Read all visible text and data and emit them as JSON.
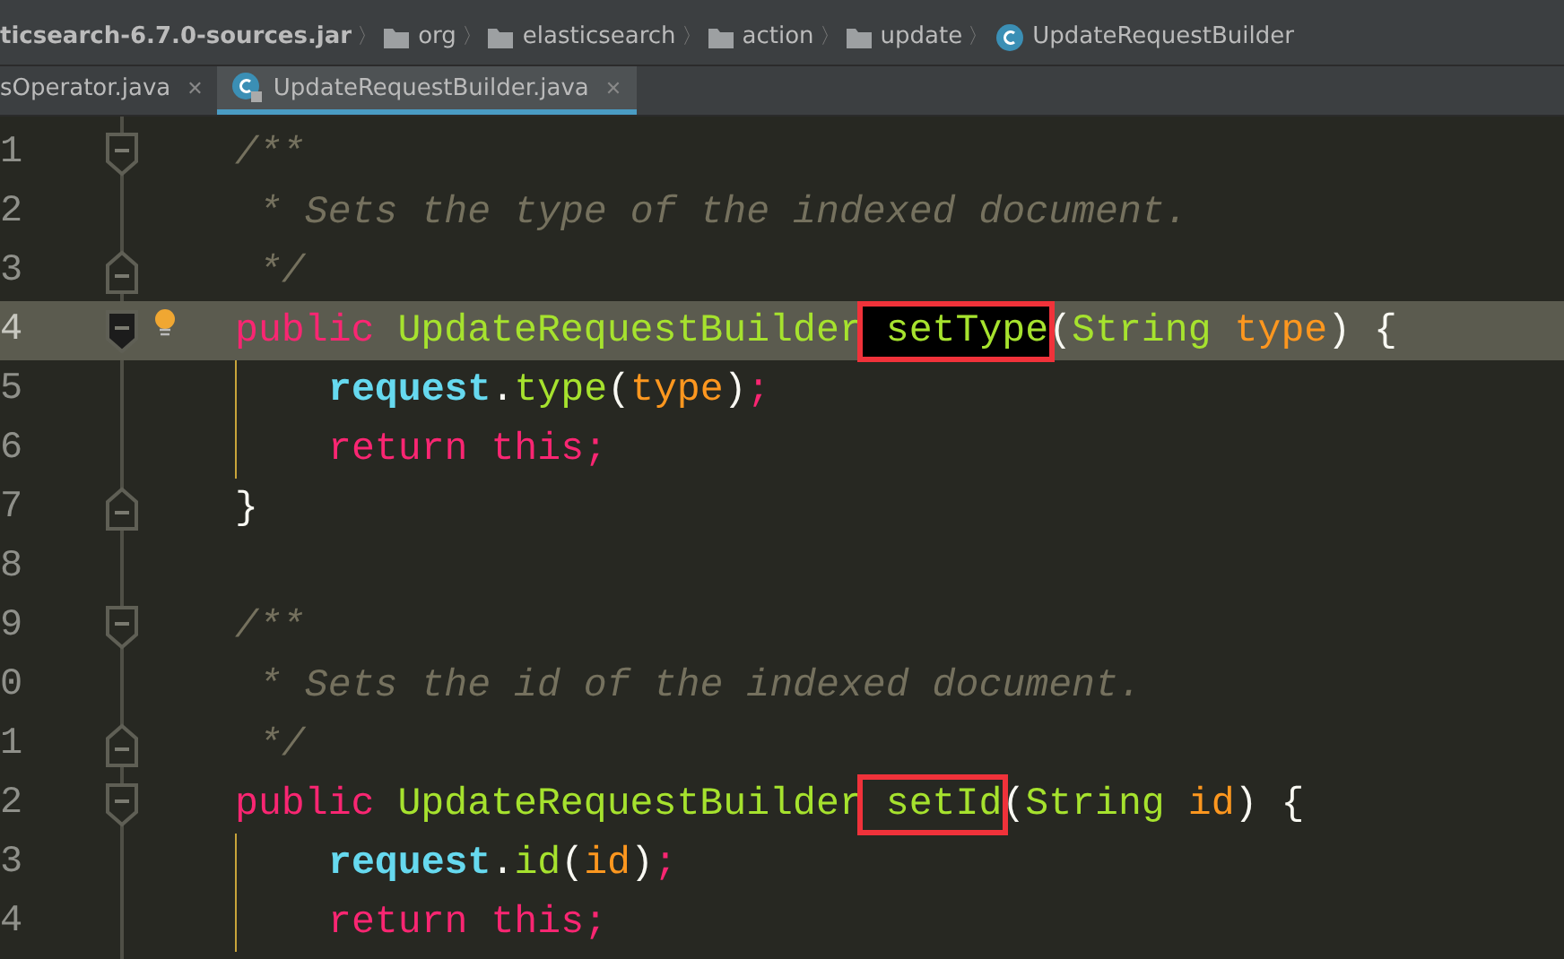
{
  "breadcrumbs": [
    {
      "label": "ticsearch-6.7.0-sources.jar",
      "kind": "jar"
    },
    {
      "separator": "〉",
      "label": "org",
      "kind": "folder"
    },
    {
      "separator": "〉",
      "label": "elasticsearch",
      "kind": "folder"
    },
    {
      "separator": "〉",
      "label": "action",
      "kind": "folder"
    },
    {
      "separator": "〉",
      "label": "update",
      "kind": "folder"
    },
    {
      "separator": "〉",
      "label": "UpdateRequestBuilder",
      "kind": "class"
    }
  ],
  "tabs": [
    {
      "label": "sOperator.java",
      "close": "✕",
      "selected": false,
      "icon": false
    },
    {
      "label": "UpdateRequestBuilder.java",
      "close": "✕",
      "selected": true,
      "icon": true
    }
  ],
  "editor": {
    "lines": [
      {
        "number": "1",
        "kind": "doc",
        "fold_start": true,
        "fold_end": false,
        "current": false,
        "bulb": false,
        "guide": false,
        "tokens": [
          {
            "text": "/**",
            "kind": "comment",
            "boxed": false
          }
        ]
      },
      {
        "number": "2",
        "kind": "doc-inner",
        "fold_start": false,
        "fold_end": false,
        "current": false,
        "bulb": false,
        "guide": false,
        "tokens": [
          {
            "text": "* Sets the type of the indexed document.",
            "kind": "comment",
            "boxed": false
          }
        ]
      },
      {
        "number": "3",
        "kind": "doc-inner",
        "fold_start": false,
        "fold_end": true,
        "current": false,
        "bulb": false,
        "guide": false,
        "tokens": [
          {
            "text": "*/",
            "kind": "comment",
            "boxed": false
          }
        ]
      },
      {
        "number": "4",
        "kind": "code",
        "fold_start": true,
        "fold_end": false,
        "current": true,
        "bulb": true,
        "guide": false,
        "tokens": [
          {
            "text": "public",
            "kind": "keyword",
            "boxed": false
          },
          {
            "text": " UpdateRequestBuilder",
            "kind": "type",
            "boxed": false
          },
          {
            "text": " setType",
            "kind": "selected-method",
            "boxed": true
          },
          {
            "text": "(",
            "kind": "plain",
            "boxed": false
          },
          {
            "text": "String",
            "kind": "type",
            "boxed": false
          },
          {
            "text": " type",
            "kind": "param",
            "boxed": false
          },
          {
            "text": ") {",
            "kind": "plain",
            "boxed": false
          }
        ]
      },
      {
        "number": "5",
        "kind": "body",
        "fold_start": false,
        "fold_end": false,
        "current": false,
        "bulb": false,
        "guide": true,
        "tokens": [
          {
            "text": "request",
            "kind": "field",
            "boxed": false
          },
          {
            "text": ".",
            "kind": "plain",
            "boxed": false
          },
          {
            "text": "type",
            "kind": "type",
            "boxed": false
          },
          {
            "text": "(",
            "kind": "plain",
            "boxed": false
          },
          {
            "text": "type",
            "kind": "param",
            "boxed": false
          },
          {
            "text": ")",
            "kind": "plain",
            "boxed": false
          },
          {
            "text": ";",
            "kind": "keyword",
            "boxed": false
          }
        ]
      },
      {
        "number": "6",
        "kind": "body",
        "fold_start": false,
        "fold_end": false,
        "current": false,
        "bulb": false,
        "guide": true,
        "tokens": [
          {
            "text": "return this;",
            "kind": "keyword",
            "boxed": false
          }
        ]
      },
      {
        "number": "7",
        "kind": "code",
        "fold_start": false,
        "fold_end": true,
        "current": false,
        "bulb": false,
        "guide": false,
        "tokens": [
          {
            "text": "}",
            "kind": "plain",
            "boxed": false
          }
        ]
      },
      {
        "number": "8",
        "kind": "code",
        "fold_start": false,
        "fold_end": false,
        "current": false,
        "bulb": false,
        "guide": false
      },
      {
        "number": "9",
        "kind": "doc",
        "fold_start": true,
        "fold_end": false,
        "current": false,
        "bulb": false,
        "guide": false,
        "tokens": [
          {
            "text": "/**",
            "kind": "comment",
            "boxed": false
          }
        ]
      },
      {
        "number": "0",
        "kind": "doc-inner",
        "fold_start": false,
        "fold_end": false,
        "current": false,
        "bulb": false,
        "guide": false,
        "tokens": [
          {
            "text": "* Sets the id of the indexed document.",
            "kind": "comment",
            "boxed": false
          }
        ]
      },
      {
        "number": "1",
        "kind": "doc-inner",
        "fold_start": false,
        "fold_end": true,
        "current": false,
        "bulb": false,
        "guide": false,
        "tokens": [
          {
            "text": "*/",
            "kind": "comment",
            "boxed": false
          }
        ]
      },
      {
        "number": "2",
        "kind": "code",
        "fold_start": true,
        "fold_end": false,
        "current": false,
        "bulb": false,
        "guide": false,
        "tokens": [
          {
            "text": "public",
            "kind": "keyword",
            "boxed": false
          },
          {
            "text": " UpdateRequestBuilder",
            "kind": "type",
            "boxed": false
          },
          {
            "text": " setId",
            "kind": "type",
            "boxed": true
          },
          {
            "text": "(",
            "kind": "plain",
            "boxed": false
          },
          {
            "text": "String",
            "kind": "type",
            "boxed": false
          },
          {
            "text": " id",
            "kind": "param",
            "boxed": false
          },
          {
            "text": ") {",
            "kind": "plain",
            "boxed": false
          }
        ]
      },
      {
        "number": "3",
        "kind": "body",
        "fold_start": false,
        "fold_end": false,
        "current": false,
        "bulb": false,
        "guide": true,
        "tokens": [
          {
            "text": "request",
            "kind": "field",
            "boxed": false
          },
          {
            "text": ".",
            "kind": "plain",
            "boxed": false
          },
          {
            "text": "id",
            "kind": "type",
            "boxed": false
          },
          {
            "text": "(",
            "kind": "plain",
            "boxed": false
          },
          {
            "text": "id",
            "kind": "param",
            "boxed": false
          },
          {
            "text": ")",
            "kind": "plain",
            "boxed": false
          },
          {
            "text": ";",
            "kind": "keyword",
            "boxed": false
          }
        ]
      },
      {
        "number": "4",
        "kind": "body",
        "fold_start": false,
        "fold_end": false,
        "current": false,
        "bulb": false,
        "guide": true,
        "tokens": [
          {
            "text": "return this;",
            "kind": "keyword",
            "boxed": false
          }
        ]
      }
    ]
  }
}
